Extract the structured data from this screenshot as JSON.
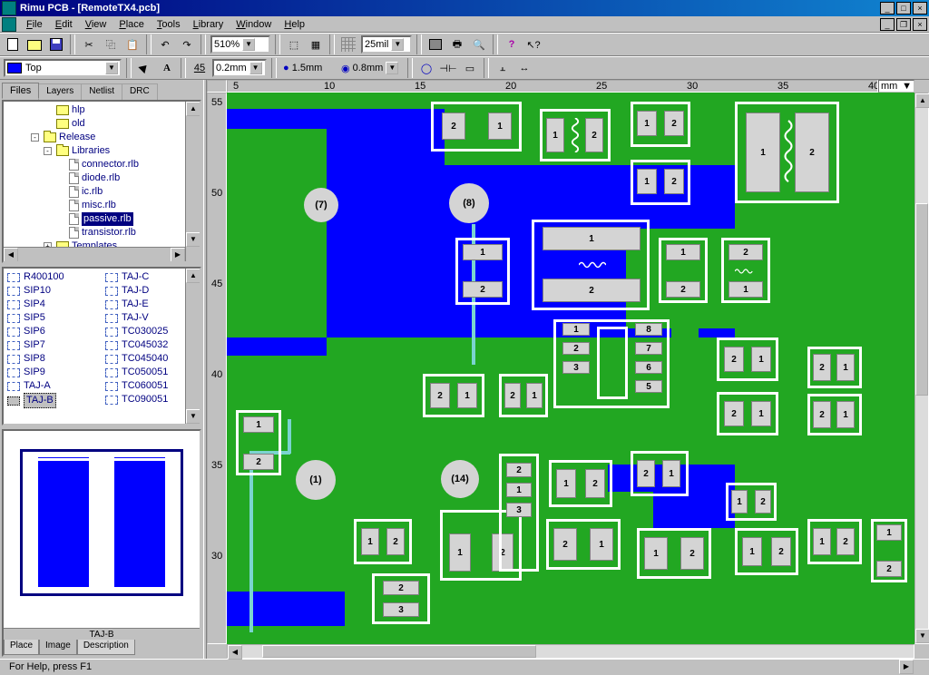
{
  "title": "Rimu PCB - [RemoteTX4.pcb]",
  "menu": [
    "File",
    "Edit",
    "View",
    "Place",
    "Tools",
    "Library",
    "Window",
    "Help"
  ],
  "toolbar1": {
    "zoom": "510%",
    "grid": "25mil"
  },
  "toolbar2": {
    "layer": "Top",
    "trace_w": "0.2mm",
    "pad1": "1.5mm",
    "pad2": "0.8mm",
    "angle": "45"
  },
  "tabs": [
    "Files",
    "Layers",
    "Netlist",
    "DRC"
  ],
  "active_tab": 0,
  "tree": {
    "items": [
      {
        "indent": 3,
        "type": "folder",
        "label": "hlp"
      },
      {
        "indent": 3,
        "type": "folder",
        "label": "old"
      },
      {
        "indent": 2,
        "type": "folder-open",
        "expander": "-",
        "label": "Release"
      },
      {
        "indent": 3,
        "type": "folder-open",
        "expander": "-",
        "label": "Libraries"
      },
      {
        "indent": 4,
        "type": "file",
        "label": "connector.rlb"
      },
      {
        "indent": 4,
        "type": "file",
        "label": "diode.rlb"
      },
      {
        "indent": 4,
        "type": "file",
        "label": "ic.rlb"
      },
      {
        "indent": 4,
        "type": "file",
        "label": "misc.rlb"
      },
      {
        "indent": 4,
        "type": "file",
        "label": "passive.rlb",
        "selected": true
      },
      {
        "indent": 4,
        "type": "file",
        "label": "transistor.rlb"
      },
      {
        "indent": 3,
        "type": "folder",
        "expander": "+",
        "label": "Templates"
      }
    ]
  },
  "list_left": [
    "R400100",
    "SIP10",
    "SIP4",
    "SIP5",
    "SIP6",
    "SIP7",
    "SIP8",
    "SIP9",
    "TAJ-A",
    "TAJ-B"
  ],
  "list_left_selected": 9,
  "list_right": [
    "TAJ-C",
    "TAJ-D",
    "TAJ-E",
    "TAJ-V",
    "TC030025",
    "TC045032",
    "TC045040",
    "TC050051",
    "TC060051",
    "TC090051"
  ],
  "preview_label": "TAJ-B",
  "bottom_tabs": [
    "Place",
    "Image",
    "Description"
  ],
  "bottom_active": 1,
  "ruler_h": [
    {
      "v": "5",
      "p": 5
    },
    {
      "v": "10",
      "p": 130
    },
    {
      "v": "15",
      "p": 258
    },
    {
      "v": "20",
      "p": 386
    },
    {
      "v": "25",
      "p": 514
    },
    {
      "v": "30",
      "p": 642
    },
    {
      "v": "35",
      "p": 770
    },
    {
      "v": "40",
      "p": 758
    }
  ],
  "ruler_h_marks": [
    "5",
    "10",
    "15",
    "20",
    "25",
    "30",
    "35",
    "40"
  ],
  "ruler_v_marks": [
    "55",
    "50",
    "45",
    "40",
    "35",
    "30"
  ],
  "unit": "mm",
  "status": "For Help, press F1",
  "pcb": {
    "pads_labeled": [
      "1",
      "2",
      "3",
      "5",
      "6",
      "7",
      "8"
    ],
    "vias": [
      "(7)",
      "(8)",
      "(1)",
      "(14)"
    ]
  }
}
